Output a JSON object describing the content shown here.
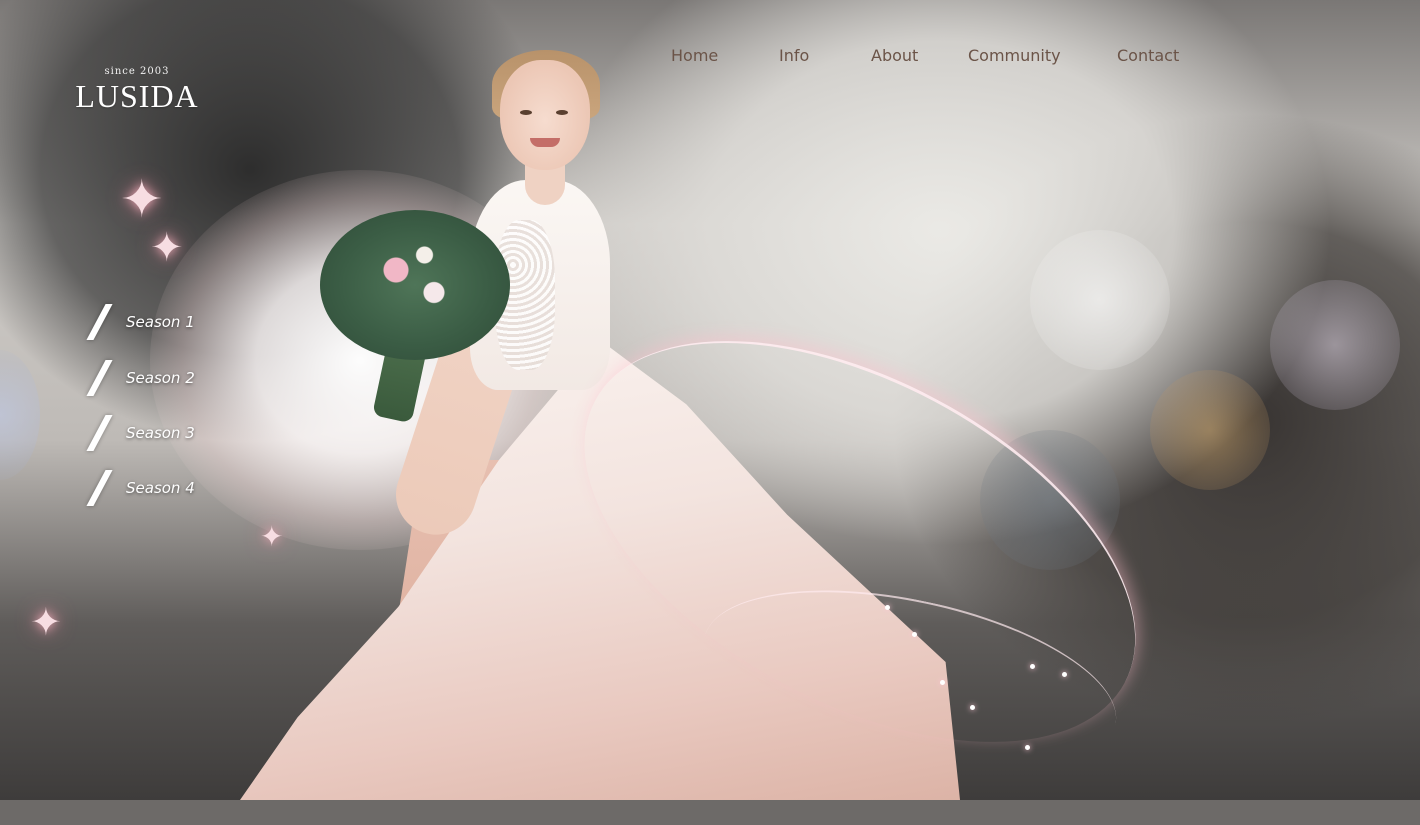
{
  "brand": {
    "tagline": "since 2003",
    "name": "LUSIDA"
  },
  "nav": {
    "items": [
      {
        "id": "home",
        "label": "Home"
      },
      {
        "id": "info",
        "label": "Info"
      },
      {
        "id": "about",
        "label": "About"
      },
      {
        "id": "community",
        "label": "Community"
      },
      {
        "id": "contact",
        "label": "Contact"
      }
    ]
  },
  "seasons": {
    "items": [
      {
        "id": "season-1",
        "label": "Season 1"
      },
      {
        "id": "season-2",
        "label": "Season 2"
      },
      {
        "id": "season-3",
        "label": "Season 3"
      },
      {
        "id": "season-4",
        "label": "Season 4"
      }
    ]
  },
  "colors": {
    "nav_text": "#6b5448",
    "accent_pink": "#e9a9b5",
    "white": "#ffffff"
  },
  "icons": {
    "season_marker": "slash-icon",
    "sparkle": "sparkle-icon"
  }
}
